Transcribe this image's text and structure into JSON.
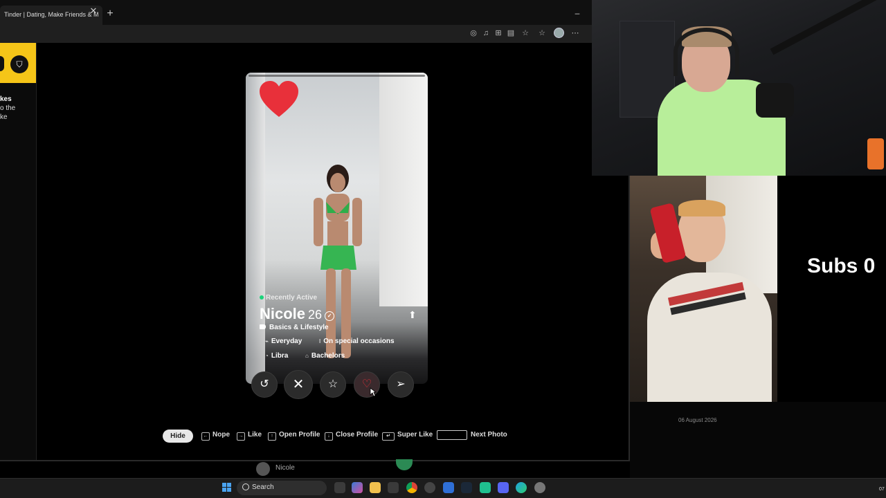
{
  "browser": {
    "tab_title": "Tinder | Dating, Make Friends & M",
    "tab_close": "✕",
    "new_tab": "+",
    "minimize": "–"
  },
  "side_panel": {
    "lines": [
      "kes",
      "o the",
      "ke"
    ]
  },
  "profile": {
    "status": "Recently Active",
    "name": "Nicole",
    "age": "26",
    "section": "Basics & Lifestyle",
    "chips": [
      {
        "icon": "drink-icon",
        "text": "Everyday"
      },
      {
        "icon": "smoke-icon",
        "text": "On special occasions"
      },
      {
        "icon": "zodiac-icon",
        "text": "Libra"
      },
      {
        "icon": "education-icon",
        "text": "Bachelors"
      }
    ]
  },
  "actions": [
    "rewind-icon",
    "nope-icon",
    "super-like-icon",
    "like-icon",
    "boost-icon"
  ],
  "hints": {
    "hide": "Hide",
    "nope": "Nope",
    "like": "Like",
    "open_profile": "Open Profile",
    "close_profile": "Close Profile",
    "super_like": "Super Like",
    "next_photo": "Next Photo"
  },
  "overlay": {
    "subs_text": "Subs 0",
    "date": "06 August 2026"
  },
  "below": {
    "nicole_label": "Nicole"
  },
  "taskbar": {
    "search_label": "Search",
    "clock": "07"
  },
  "colors": {
    "tinder_yellow": "#f5c518",
    "like_red": "#e8303a",
    "active_green": "#1bd37a"
  }
}
